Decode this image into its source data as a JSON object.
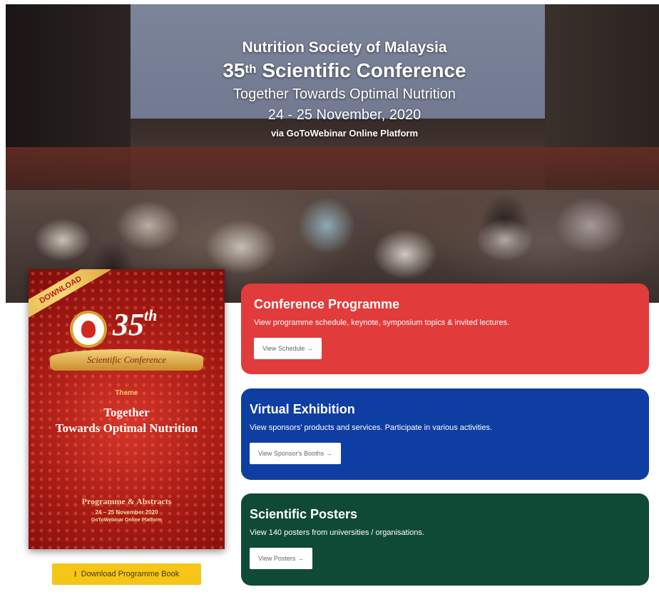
{
  "hero": {
    "org": "Nutrition Society of Malaysia",
    "title_number": "35",
    "title_sup": "th",
    "title_rest": "Scientific Conference",
    "theme": "Together Towards Optimal Nutrition",
    "date": "24 - 25 November, 2020",
    "platform": "via GoToWebinar Online Platform"
  },
  "cover": {
    "ribbon": "DOWNLOAD",
    "number": "35",
    "number_sup": "th",
    "banner": "Scientific Conference",
    "theme_label": "Theme",
    "theme_line1": "Together",
    "theme_line2": "Towards Optimal Nutrition",
    "programme": "Programme & Abstracts",
    "date": "24 – 25 November 2020",
    "platform": "GoToWebinar Online Platform"
  },
  "download": {
    "label": "Download Programme Book",
    "icon": "download-icon",
    "color": "#f5c518"
  },
  "cards": {
    "programme": {
      "title": "Conference Programme",
      "desc": "View programme schedule, keynote, symposium topics & invited lectures.",
      "button": "View Schedule →",
      "color": "#e23b3b"
    },
    "exhibition": {
      "title": "Virtual Exhibition",
      "desc": "View sponsors' products and services. Participate in various activities.",
      "button": "View Sponsor's Booths →",
      "color": "#0f3ea3"
    },
    "posters": {
      "title": "Scientific Posters",
      "desc": "View 140 posters from universities / organisations.",
      "button": "View Posters →",
      "color": "#0f4a36"
    }
  }
}
